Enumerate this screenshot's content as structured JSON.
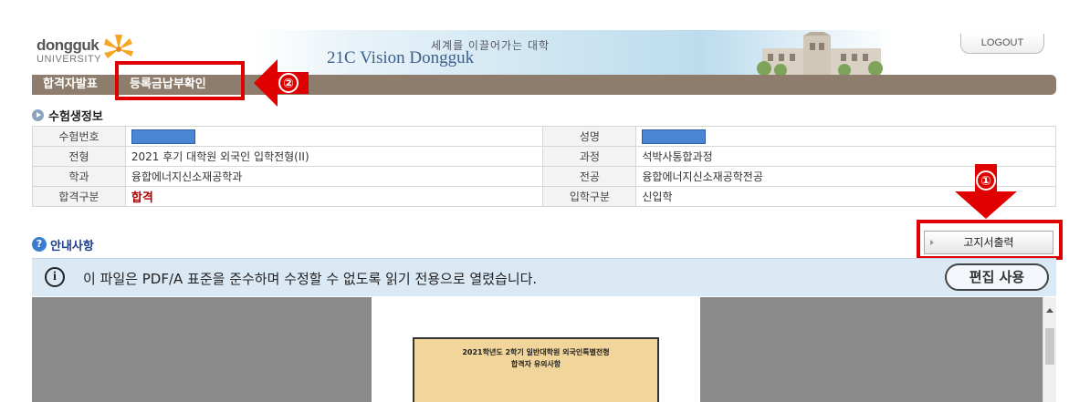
{
  "header": {
    "logo_line1": "dongguk",
    "logo_line2": "UNIVERSITY",
    "banner_sub": "세계를 이끌어가는 대학",
    "banner_title": "21C Vision Dongguk",
    "logout_label": "LOGOUT"
  },
  "nav": {
    "items": [
      {
        "label": "합격자발표"
      },
      {
        "label": "등록금납부확인"
      }
    ]
  },
  "annotations": {
    "marker_nav": "②",
    "marker_print": "①",
    "highlight_color": "#e00000"
  },
  "applicant_section": {
    "title": "수험생정보",
    "rows": [
      {
        "label1": "수험번호",
        "value1": "",
        "label2": "성명",
        "value2": ""
      },
      {
        "label1": "전형",
        "value1": "2021  후기 대학원 외국인 입학전형(II)",
        "label2": "과정",
        "value2": "석박사통합과정"
      },
      {
        "label1": "학과",
        "value1": "융합에너지신소재공학과",
        "label2": "전공",
        "value2": "융합에너지신소재공학전공"
      },
      {
        "label1": "합격구분",
        "value1": "합격",
        "label2": "입학구분",
        "value2": "신입학"
      }
    ]
  },
  "notice": {
    "title": "안내사항",
    "print_button": "고지서출력"
  },
  "pdf_bar": {
    "message": "이 파일은 PDF/A 표준을 준수하며 수정할 수 없도록 읽기 전용으로 열렸습니다.",
    "edit_button": "편집 사용"
  },
  "pdf_page": {
    "line1": "2021학년도 2학기 일반대학원 외국인특별전형",
    "line2": "합격자 유의사항"
  },
  "colors": {
    "nav_bg": "#8e7d6d",
    "mask": "#4a86d4",
    "pass_red": "#b00000",
    "pdf_bar_bg": "#dbe9f5",
    "viewer_bg": "#8a8a8a"
  }
}
